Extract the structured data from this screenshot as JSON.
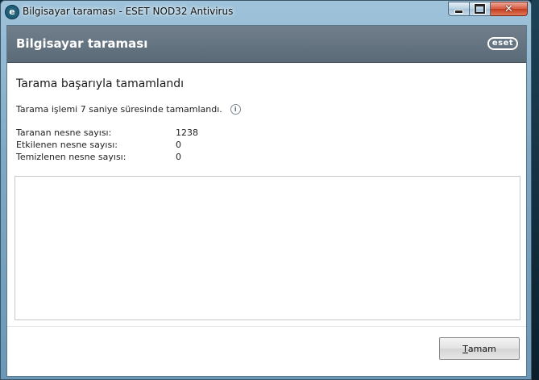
{
  "window": {
    "title": "Bilgisayar taraması - ESET NOD32 Antivirus",
    "app_icon_letter": "e",
    "controls": {
      "minimize": "minimize",
      "maximize": "maximize",
      "close": "✕"
    }
  },
  "header": {
    "title": "Bilgisayar taraması",
    "logo_text": "eset"
  },
  "content": {
    "heading": "Tarama başarıyla tamamlandı",
    "summary": "Tarama işlemi 7 saniye süresinde tamamlandı.",
    "info_glyph": "i",
    "stats": [
      {
        "label": "Taranan nesne sayısı:",
        "value": "1238"
      },
      {
        "label": "Etkilenen nesne sayısı:",
        "value": "0"
      },
      {
        "label": "Temizlenen nesne sayısı:",
        "value": "0"
      }
    ]
  },
  "footer": {
    "ok_mnemonic": "T",
    "ok_rest": "amam"
  },
  "colors": {
    "header_bg": "#5f6e7a",
    "close_button": "#c94a2e"
  },
  "icons": [
    "app-icon",
    "info-icon",
    "eset-logo",
    "minimize-icon",
    "maximize-icon",
    "close-icon"
  ]
}
